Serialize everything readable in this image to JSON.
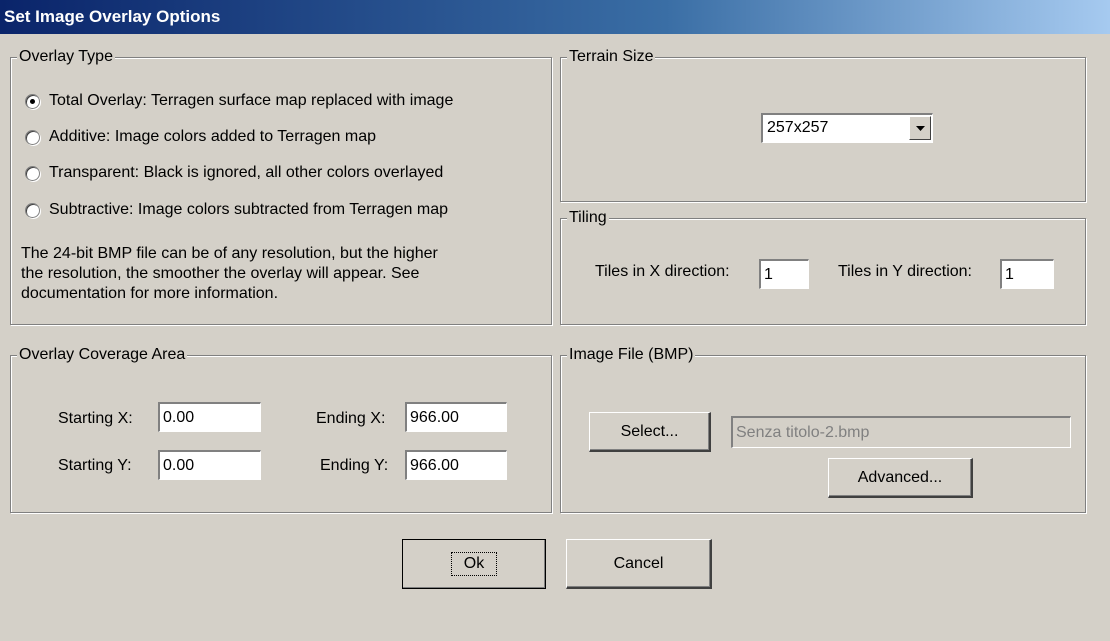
{
  "window": {
    "title": "Set Image Overlay Options"
  },
  "overlay_type": {
    "legend": "Overlay Type",
    "options": [
      {
        "label": "Total Overlay: Terragen surface map replaced with image",
        "selected": true
      },
      {
        "label": "Additive: Image colors added to Terragen map",
        "selected": false
      },
      {
        "label": "Transparent: Black is ignored, all other colors overlayed",
        "selected": false
      },
      {
        "label": "Subtractive: Image colors subtracted from Terragen map",
        "selected": false
      }
    ],
    "note_lines": [
      "The 24-bit BMP file can be of any resolution, but the higher",
      "the resolution, the smoother the overlay will appear. See",
      "documentation for more information."
    ]
  },
  "terrain_size": {
    "legend": "Terrain Size",
    "selected": "257x257",
    "arrow_icon": "triangle-down"
  },
  "tiling": {
    "legend": "Tiling",
    "x_label": "Tiles in X direction:",
    "x_value": "1",
    "y_label": "Tiles in Y direction:",
    "y_value": "1"
  },
  "coverage": {
    "legend": "Overlay Coverage Area",
    "start_x_label": "Starting X:",
    "start_x_value": "0.00",
    "start_y_label": "Starting Y:",
    "start_y_value": "0.00",
    "end_x_label": "Ending X:",
    "end_x_value": "966.00",
    "end_y_label": "Ending Y:",
    "end_y_value": "966.00"
  },
  "image_file": {
    "legend": "Image File (BMP)",
    "select_label": "Select...",
    "file_name": "Senza titolo-2.bmp",
    "advanced_label": "Advanced..."
  },
  "buttons": {
    "ok_label": "Ok",
    "cancel_label": "Cancel"
  },
  "colors": {
    "titlebar_start": "#0a246a",
    "titlebar_end": "#a6caf0",
    "dialog_bg": "#d4d0c8"
  }
}
